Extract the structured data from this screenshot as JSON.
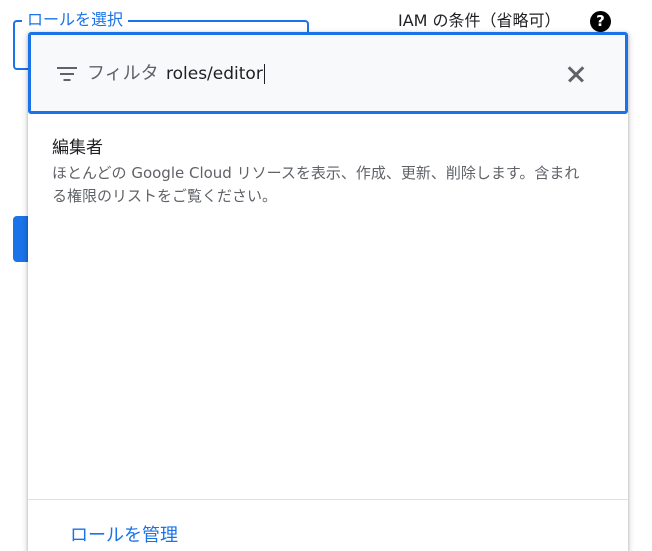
{
  "background": {
    "role_select_label": "ロールを選択",
    "iam_condition_label": "IAM の条件（省略可）",
    "help_icon_glyph": "?"
  },
  "filter": {
    "label": "フィルタ",
    "value": "roles/editor",
    "icon": "filter-list-icon",
    "clear_icon": "close-icon"
  },
  "results": [
    {
      "title": "編集者",
      "description": "ほとんどの Google Cloud リソースを表示、作成、更新、削除します。含まれる権限のリストをご覧ください。"
    }
  ],
  "footer": {
    "manage_roles_label": "ロールを管理"
  },
  "colors": {
    "accent": "#1a73e8",
    "text_primary": "#202124",
    "text_secondary": "#5f6368"
  }
}
